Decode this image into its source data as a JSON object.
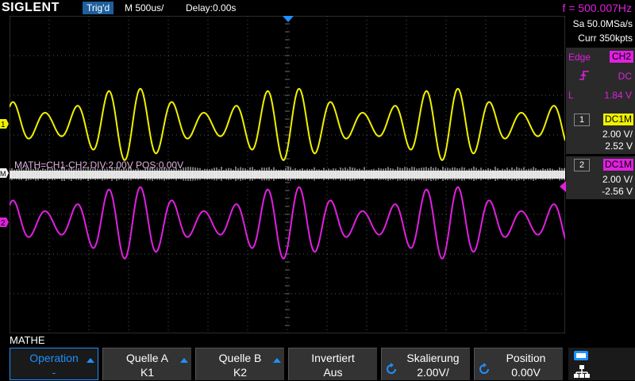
{
  "header": {
    "logo": "SIGLENT",
    "trigger_state": "Trig'd",
    "timebase": "M 500us/",
    "delay": "Delay:0.00s",
    "frequency": "f = 500.007Hz"
  },
  "acquisition": {
    "sample_rate": "Sa 50.0MSa/s",
    "memory": "Curr 350kpts"
  },
  "trigger": {
    "type": "Edge",
    "source": "CH2",
    "coupling": "DC",
    "level_label": "L",
    "level": "1.84 V"
  },
  "channels": [
    {
      "num": "1",
      "coupling": "DC1M",
      "scale": "2.00 V/",
      "offset": "2.52 V",
      "color": "#f0f000"
    },
    {
      "num": "2",
      "coupling": "DC1M",
      "scale": "2.00 V/",
      "offset": "-2.56 V",
      "color": "#e020e0"
    }
  ],
  "markers": {
    "ch1": "1",
    "math": "M",
    "ch2": "2"
  },
  "math_info": "MATH=CH1-CH2  DIV:2.00V  POS:0.00V",
  "menu": {
    "title": "MATHE",
    "buttons": [
      {
        "l1": "Operation",
        "l2": "-"
      },
      {
        "l1": "Quelle A",
        "l2": "K1"
      },
      {
        "l1": "Quelle B",
        "l2": "K2"
      },
      {
        "l1": "Invertiert",
        "l2": "Aus"
      },
      {
        "l1": "Skalierung",
        "l2": "2.00V/"
      },
      {
        "l1": "Position",
        "l2": "0.00V"
      }
    ]
  },
  "colors": {
    "ch1": "#f0f000",
    "ch2": "#e020e0",
    "math": "#f0f0f0",
    "accent": "#1e90ff",
    "grid": "#555555"
  }
}
